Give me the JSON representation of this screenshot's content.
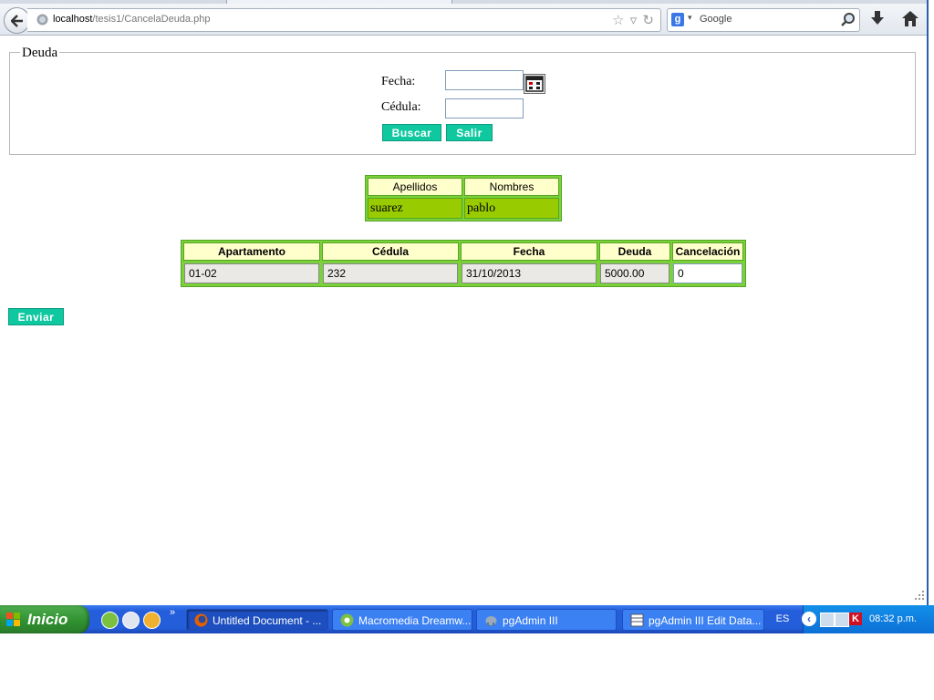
{
  "browser": {
    "url_host": "localhost",
    "url_path": "/tesis1/CancelaDeuda.php",
    "search_placeholder": "Google"
  },
  "form": {
    "legend": "Deuda",
    "fecha_label": "Fecha:",
    "fecha_value": "",
    "cedula_label": "Cédula:",
    "cedula_value": "",
    "buscar_label": "Buscar",
    "salir_label": "Salir"
  },
  "names_table": {
    "headers": [
      "Apellidos",
      "Nombres"
    ],
    "row": [
      "suarez",
      "pablo"
    ]
  },
  "debt_table": {
    "headers": [
      "Apartamento",
      "Cédula",
      "Fecha",
      "Deuda",
      "Cancelación"
    ],
    "row": [
      "01-02",
      "232",
      "31/10/2013",
      "5000.00",
      "0"
    ]
  },
  "enviar_label": "Enviar",
  "taskbar": {
    "start_label": "Inicio",
    "tasks": [
      "Untitled Document - ...",
      "Macromedia Dreamw...",
      "pgAdmin III",
      "pgAdmin III Edit Data..."
    ],
    "language": "ES",
    "clock": "08:32 p.m."
  },
  "colors": {
    "button_green": "#10c8a0",
    "table_border_green": "#7bd13a",
    "header_yellow": "#ffffcc",
    "cell_olive": "#99cc00",
    "taskbar_blue": "#245edb"
  }
}
